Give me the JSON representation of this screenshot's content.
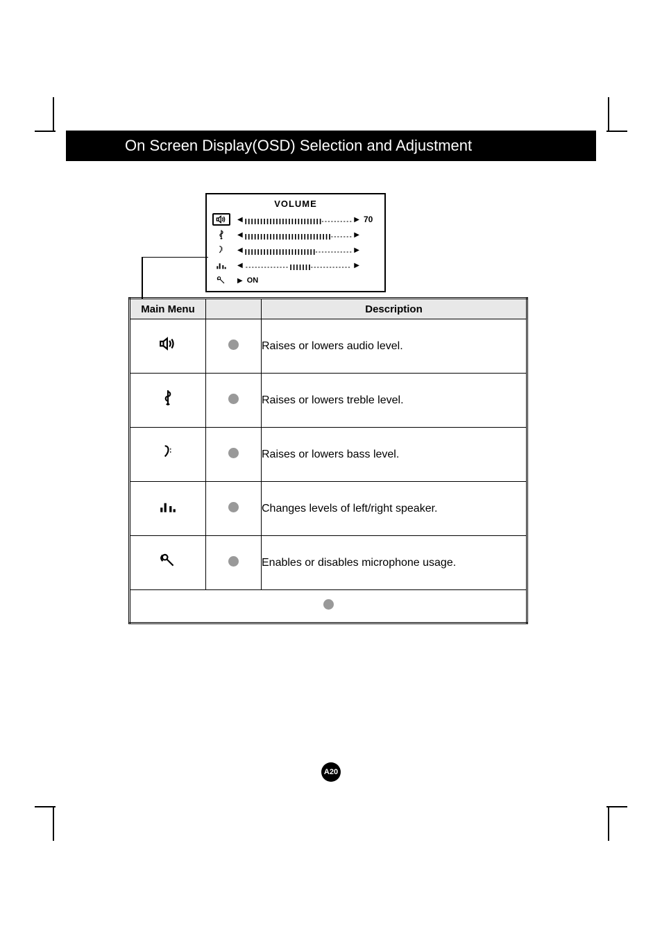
{
  "header": {
    "title": "On Screen Display(OSD) Selection and Adjustment"
  },
  "osd": {
    "title": "VOLUME",
    "value": "70",
    "on_label": "ON",
    "on_prefix": "▶"
  },
  "table": {
    "headers": {
      "menu": "Main Menu",
      "desc": "Description"
    },
    "rows": [
      {
        "icon": "volume-icon",
        "desc": "Raises or lowers audio level."
      },
      {
        "icon": "treble-icon",
        "desc": "Raises or lowers treble level."
      },
      {
        "icon": "bass-icon",
        "desc": "Raises or lowers bass level."
      },
      {
        "icon": "balance-icon",
        "desc": "Changes levels of left/right speaker."
      },
      {
        "icon": "mic-icon",
        "desc": "Enables or disables microphone usage."
      }
    ]
  },
  "page": "A20"
}
